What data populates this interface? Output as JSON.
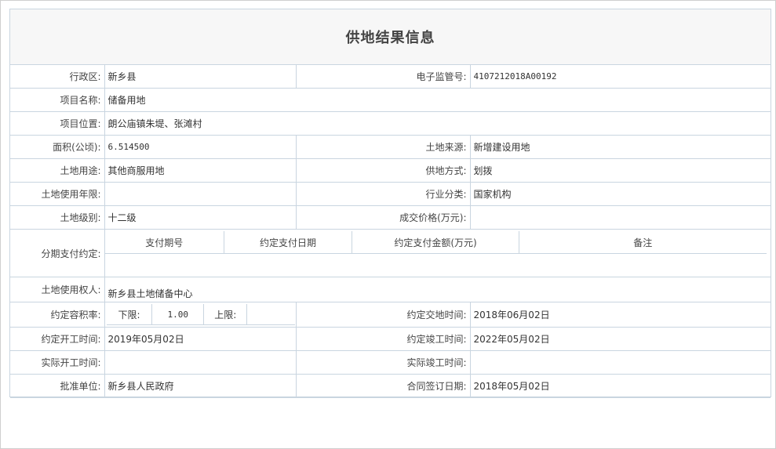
{
  "page_title": "供地结果信息",
  "fields": {
    "admin_region": {
      "label": "行政区:",
      "value": "新乡县"
    },
    "supervision_no": {
      "label": "电子监管号:",
      "value": "4107212018A00192"
    },
    "project_name": {
      "label": "项目名称:",
      "value": "储备用地"
    },
    "project_location": {
      "label": "项目位置:",
      "value": "朗公庙镇朱堤、张滩村"
    },
    "area": {
      "label": "面积(公顷):",
      "value": "6.514500"
    },
    "land_source": {
      "label": "土地来源:",
      "value": "新增建设用地"
    },
    "land_use": {
      "label": "土地用途:",
      "value": "其他商服用地"
    },
    "supply_method": {
      "label": "供地方式:",
      "value": "划拨"
    },
    "use_term": {
      "label": "土地使用年限:",
      "value": ""
    },
    "industry": {
      "label": "行业分类:",
      "value": "国家机构"
    },
    "land_grade": {
      "label": "土地级别:",
      "value": "十二级"
    },
    "deal_price": {
      "label": "成交价格(万元):",
      "value": ""
    },
    "installment": {
      "label": "分期支付约定:",
      "headers": [
        "支付期号",
        "约定支付日期",
        "约定支付金额(万元)",
        "备注"
      ]
    },
    "land_user": {
      "label": "土地使用权人:",
      "value": "新乡县土地储备中心"
    },
    "plot_ratio": {
      "label": "约定容积率:",
      "lower_label": "下限:",
      "lower_value": "1.00",
      "upper_label": "上限:",
      "upper_value": ""
    },
    "handover_time": {
      "label": "约定交地时间:",
      "value": "2018年06月02日"
    },
    "planned_start": {
      "label": "约定开工时间:",
      "value": "2019年05月02日"
    },
    "planned_complete": {
      "label": "约定竣工时间:",
      "value": "2022年05月02日"
    },
    "actual_start": {
      "label": "实际开工时间:",
      "value": ""
    },
    "actual_complete": {
      "label": "实际竣工时间:",
      "value": ""
    },
    "approval_unit": {
      "label": "批准单位:",
      "value": "新乡县人民政府"
    },
    "contract_date": {
      "label": "合同签订日期:",
      "value": "2018年05月02日"
    }
  }
}
